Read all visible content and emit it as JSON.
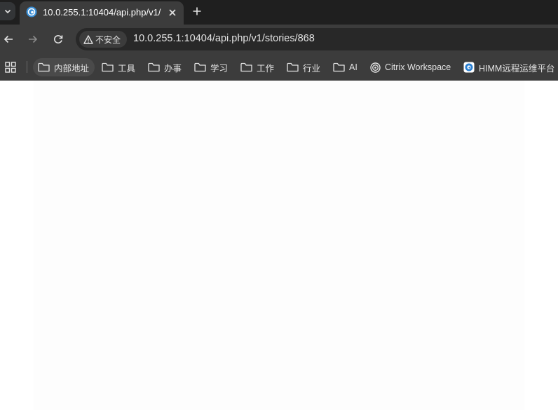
{
  "browser": {
    "tab": {
      "title": "10.0.255.1:10404/api.php/v1/",
      "favicon": "site-favicon-icon"
    },
    "toolbar": {
      "security_label": "不安全",
      "url": "10.0.255.1:10404/api.php/v1/stories/868"
    },
    "bookmarks": [
      {
        "label": "内部地址",
        "icon": "folder-icon"
      },
      {
        "label": "工具",
        "icon": "folder-icon"
      },
      {
        "label": "办事",
        "icon": "folder-icon"
      },
      {
        "label": "学习",
        "icon": "folder-icon"
      },
      {
        "label": "工作",
        "icon": "folder-icon"
      },
      {
        "label": "行业",
        "icon": "folder-icon"
      },
      {
        "label": "AI",
        "icon": "folder-icon"
      },
      {
        "label": "Citrix Workspace",
        "icon": "citrix-icon"
      },
      {
        "label": "HIMM远程运维平台",
        "icon": "himm-icon"
      }
    ]
  },
  "colors": {
    "tabstrip_bg": "#1f1f1f",
    "toolbar_bg": "#3c3c3c",
    "omnibox_bg": "#282828",
    "text": "#e3e3e3",
    "page_bg": "#ffffff"
  }
}
